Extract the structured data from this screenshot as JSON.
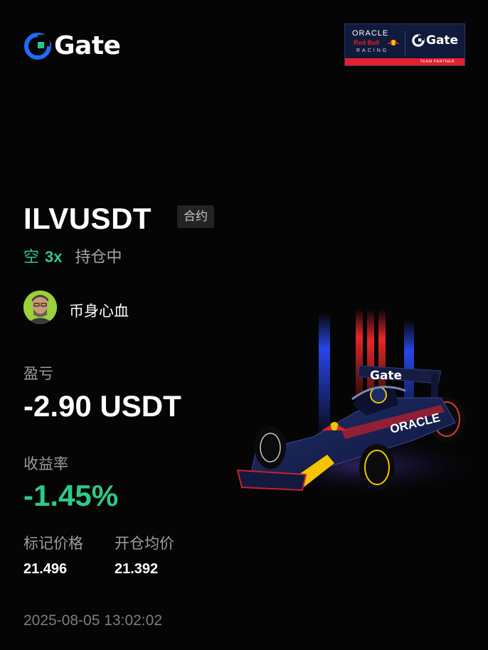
{
  "brand": {
    "logo_text": "Gate",
    "logo_color": "#1f6bff",
    "accent_green": "#2ec98a"
  },
  "partner_badge": {
    "oracle": "ORACLE",
    "red_bull": "Red Bull",
    "racing": "RACING",
    "gate": "Gate",
    "strip": "TEAM PARTNER"
  },
  "position": {
    "symbol": "ILVUSDT",
    "type_tag": "合约",
    "side": "空",
    "leverage": "3x",
    "status": "持仓中"
  },
  "user": {
    "name": "币身心血"
  },
  "stats": {
    "pnl_label": "盈亏",
    "pnl_value": "-2.90 USDT",
    "roi_label": "收益率",
    "roi_value": "-1.45%",
    "mark_price_label": "标记价格",
    "mark_price_value": "21.496",
    "entry_price_label": "开仓均价",
    "entry_price_value": "21.392"
  },
  "timestamp": "2025-08-05 13:02:02",
  "car_wing_text": "Gate",
  "car_sidepod_text": "ORACLE"
}
